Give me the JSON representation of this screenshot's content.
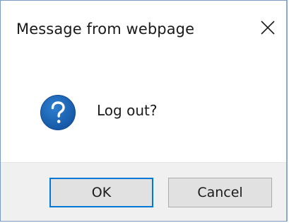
{
  "dialog": {
    "title": "Message from webpage",
    "close_icon": "close-icon",
    "message": "Log out?",
    "message_icon": "question-icon",
    "buttons": {
      "ok_label": "OK",
      "cancel_label": "Cancel"
    }
  },
  "colors": {
    "accent": "#0078d7",
    "icon_blue": "#1d63b1",
    "footer_bg": "#f0f0f0",
    "button_bg": "#e1e1e1"
  }
}
